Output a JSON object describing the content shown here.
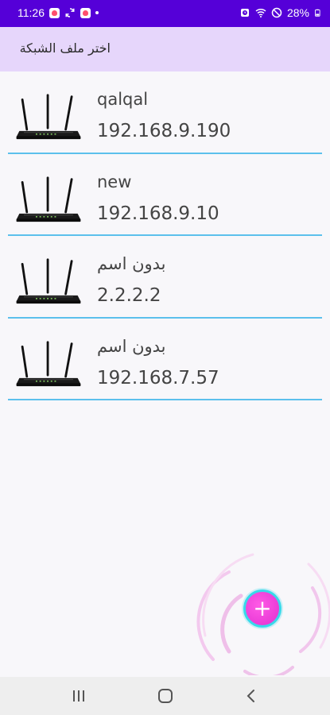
{
  "status_bar": {
    "time": "11:26",
    "battery": "28%",
    "icons": [
      "app-notification-icon",
      "sync-icon",
      "app-notification-icon",
      "dot-icon",
      "alarm-icon",
      "wifi-icon",
      "dnd-icon",
      "battery-icon"
    ]
  },
  "app_bar": {
    "title": "اختر ملف الشبكة"
  },
  "profiles": [
    {
      "name": "qalqal",
      "ip": "192.168.9.190",
      "icon": "router-icon"
    },
    {
      "name": "new",
      "ip": "192.168.9.10",
      "icon": "router-icon"
    },
    {
      "name": "بدون اسم",
      "ip": "2.2.2.2",
      "icon": "router-icon"
    },
    {
      "name": "بدون اسم",
      "ip": "192.168.7.57",
      "icon": "router-icon"
    }
  ],
  "fab": {
    "label": "+",
    "icon": "plus-icon"
  },
  "nav_bar": {
    "buttons": [
      "recents-icon",
      "home-icon",
      "back-icon"
    ]
  },
  "colors": {
    "status_bar": "#5500d8",
    "app_bar": "#e6d6fb",
    "divider": "#5cc0ec",
    "fab": "#e12fd0",
    "fab_ring": "#38d9ea"
  }
}
